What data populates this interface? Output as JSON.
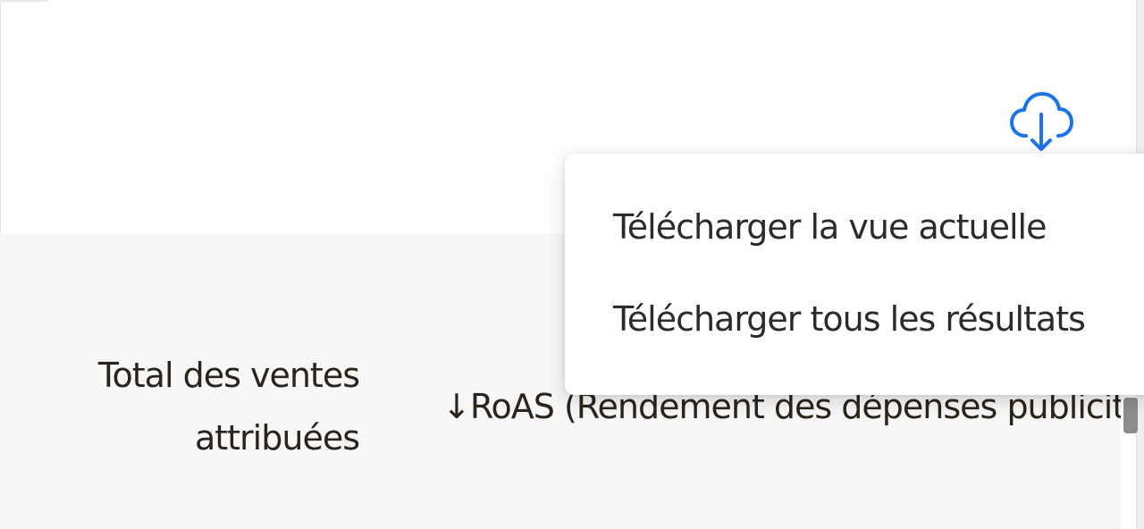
{
  "toolbar": {
    "download_icon": "cloud-download-icon",
    "accent_color": "#1a73e8"
  },
  "download_menu": {
    "items": [
      {
        "label": "Télécharger la vue actuelle"
      },
      {
        "label": "Télécharger tous les résultats"
      }
    ]
  },
  "table": {
    "columns": [
      {
        "line1": "Total des ventes",
        "line2": "attribuées"
      },
      {
        "label": "↓RoAS (Rendement des dépenses publicitaires)"
      }
    ]
  }
}
